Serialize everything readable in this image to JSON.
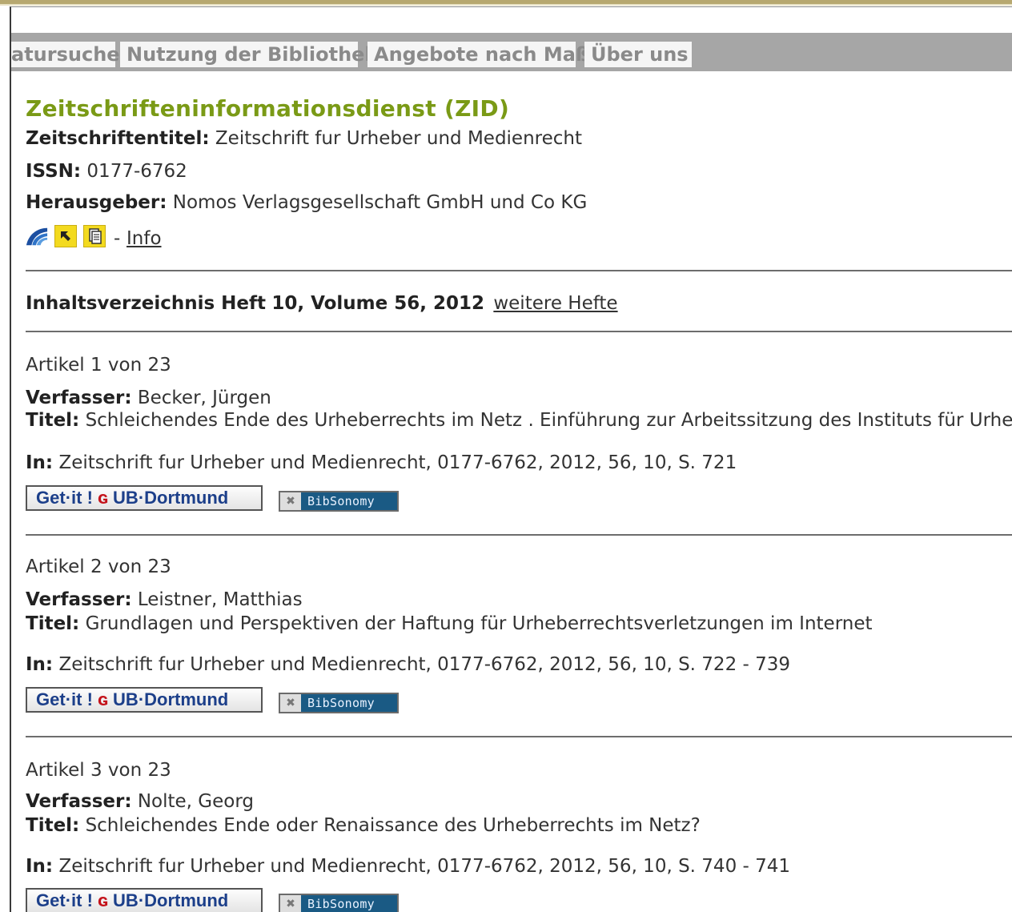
{
  "nav": {
    "tabs": [
      {
        "label": "atursuche"
      },
      {
        "label": "Nutzung der Bibliothek"
      },
      {
        "label": "Angebote nach Maß"
      },
      {
        "label": "Über uns"
      }
    ]
  },
  "journal": {
    "title": "Zeitschrifteninformationsdienst (ZID)",
    "title_label": "Zeitschriftentitel:",
    "title_value": "Zeitschrift fur Urheber und Medienrecht",
    "issn_label": "ISSN:",
    "issn_value": "0177-6762",
    "publisher_label": "Herausgeber:",
    "publisher_value": "Nomos Verlagsgesellschaft GmbH und Co KG",
    "info_sep": "-",
    "info_link": "Info"
  },
  "toc": {
    "label": "Inhaltsverzeichnis Heft",
    "issue": "10, Volume 56, 2012",
    "more_link": "weitere Hefte"
  },
  "buttons": {
    "getit_a": "Get",
    "getit_b": "it !",
    "getit_c": "UB",
    "getit_d": "Dortmund",
    "bibsonomy": "BibSonomy"
  },
  "labels": {
    "author": "Verfasser:",
    "title": "Titel:",
    "in": "In:"
  },
  "articles": [
    {
      "counter": "Artikel 1 von 23",
      "author": "Becker, Jürgen",
      "title": "Schleichendes Ende des Urheberrechts im Netz . Einführung zur Arbeitssitzung des Instituts für Urheber",
      "source": "Zeitschrift fur Urheber und Medienrecht, 0177-6762, 2012, 56, 10, S. 721"
    },
    {
      "counter": "Artikel 2 von 23",
      "author": "Leistner, Matthias",
      "title": "Grundlagen und Perspektiven der Haftung für Urheberrechtsverletzungen im Internet",
      "source": "Zeitschrift fur Urheber und Medienrecht, 0177-6762, 2012, 56, 10, S. 722 - 739"
    },
    {
      "counter": "Artikel 3 von 23",
      "author": "Nolte, Georg",
      "title": "Schleichendes Ende oder Renaissance des Urheberrechts im Netz?",
      "source": "Zeitschrift fur Urheber und Medienrecht, 0177-6762, 2012, 56, 10, S. 740 - 741"
    }
  ]
}
